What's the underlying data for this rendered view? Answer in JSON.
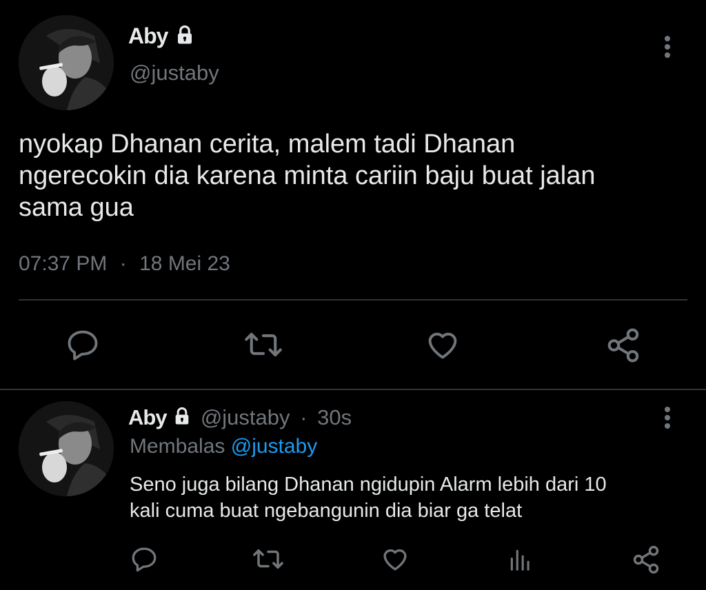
{
  "main_tweet": {
    "name": "Aby",
    "handle": "@justaby",
    "text_line1": "nyokap Dhanan cerita, malem tadi Dhanan",
    "text_line2": "ngerecokin dia karena minta cariin baju buat jalan",
    "text_line3": "sama gua",
    "time": "07:37 PM",
    "separator": "·",
    "date": "18 Mei 23"
  },
  "reply_tweet": {
    "name": "Aby",
    "handle": "@justaby",
    "separator": "·",
    "age": "30s",
    "replying_label": "Membalas",
    "replying_to": "@justaby",
    "text_line1": "Seno juga bilang Dhanan ngidupin Alarm lebih dari 10",
    "text_line2": "kali cuma buat ngebangunin dia biar ga telat"
  },
  "icons": {
    "lock": "lock-icon",
    "more": "more-vertical-icon",
    "reply": "reply-icon",
    "retweet": "retweet-icon",
    "like": "heart-icon",
    "share": "share-icon",
    "views": "views-icon"
  },
  "colors": {
    "background": "#000000",
    "text": "#e7e9ea",
    "muted": "#71767b",
    "link": "#1d9bf0",
    "divider": "#2f3336"
  }
}
